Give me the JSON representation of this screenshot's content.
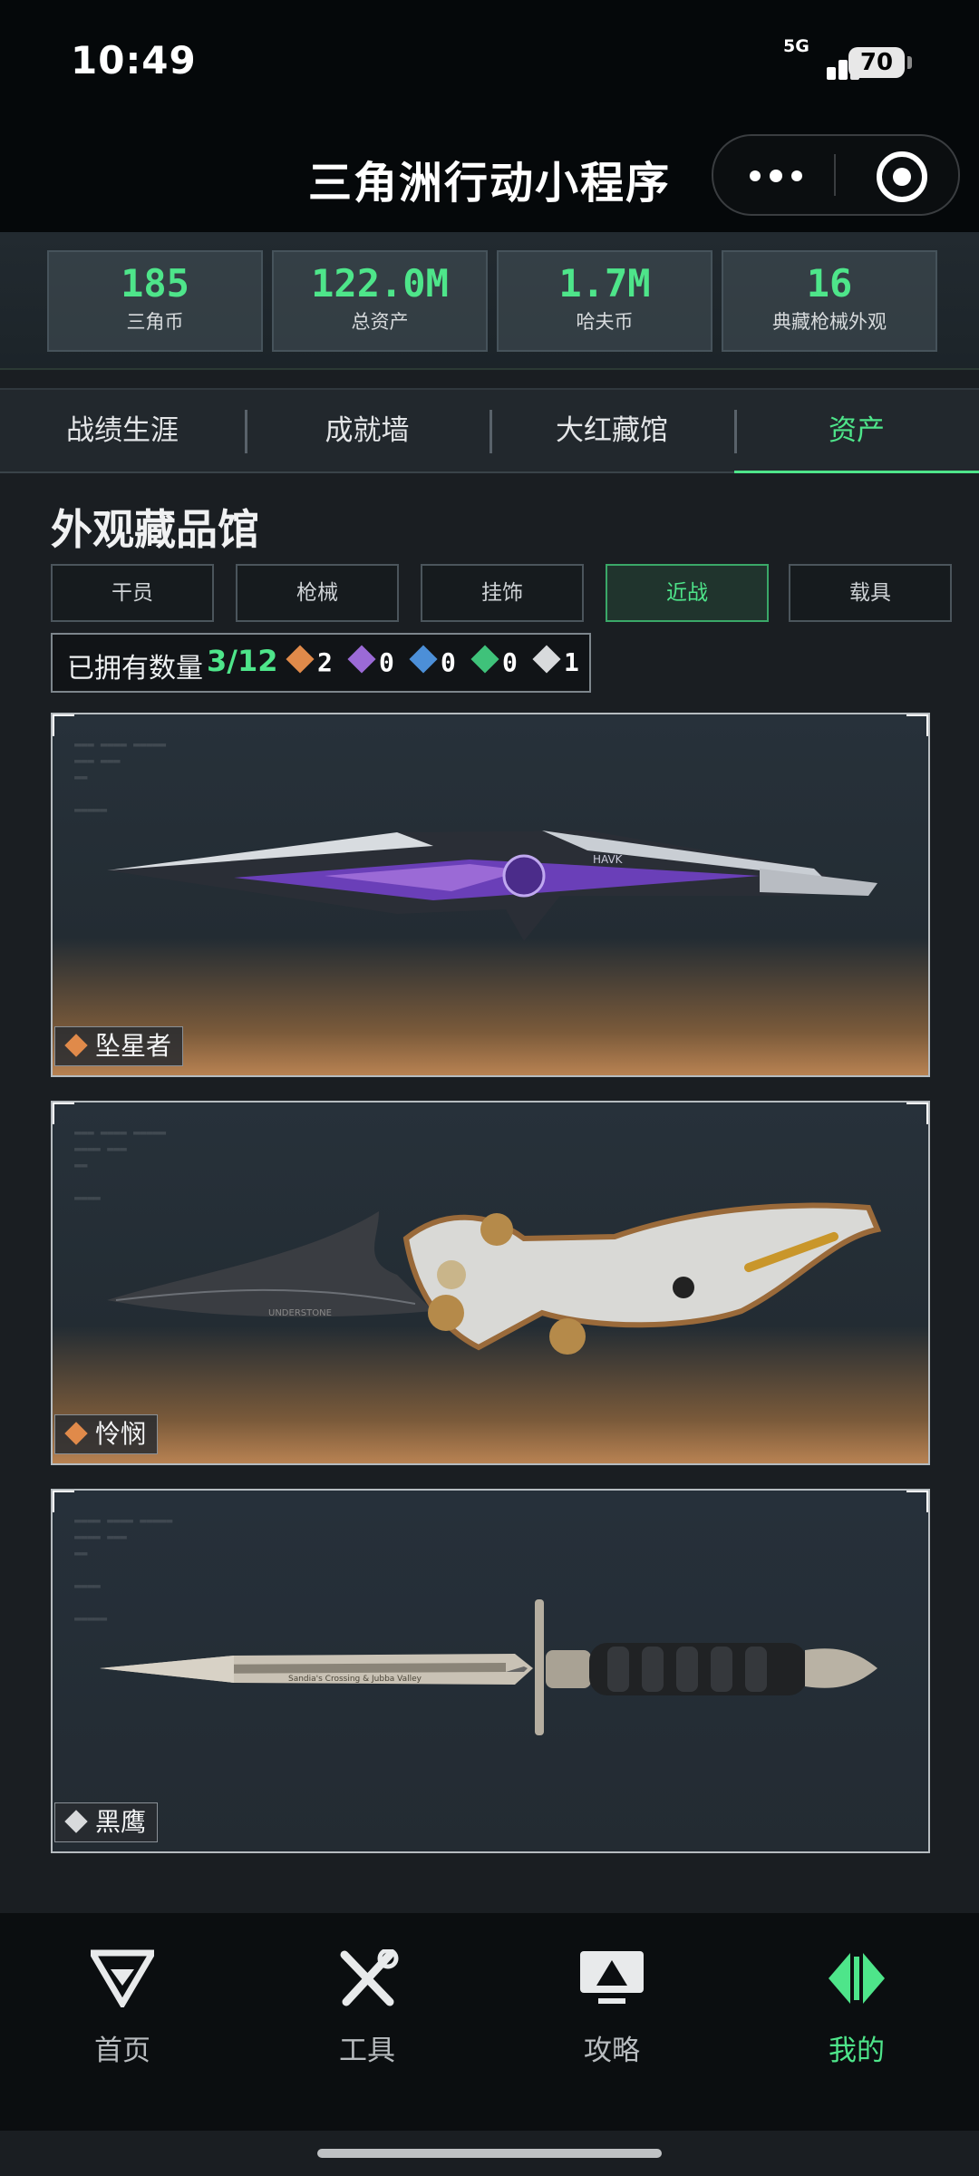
{
  "status_bar": {
    "time": "10:49",
    "network": "5G",
    "battery": "70"
  },
  "title_bar": {
    "title": "三角洲行动小程序"
  },
  "stats": [
    {
      "value": "185",
      "label": "三角币"
    },
    {
      "value": "122.0M",
      "label": "总资产"
    },
    {
      "value": "1.7M",
      "label": "哈夫币"
    },
    {
      "value": "16",
      "label": "典藏枪械外观"
    }
  ],
  "tabs": [
    {
      "label": "战绩生涯",
      "active": false
    },
    {
      "label": "成就墙",
      "active": false
    },
    {
      "label": "大红藏馆",
      "active": false
    },
    {
      "label": "资产",
      "active": true
    }
  ],
  "section": {
    "title": "外观藏品馆"
  },
  "categories": [
    {
      "label": "干员",
      "active": false
    },
    {
      "label": "枪械",
      "active": false
    },
    {
      "label": "挂饰",
      "active": false
    },
    {
      "label": "近战",
      "active": true
    },
    {
      "label": "载具",
      "active": false
    }
  ],
  "owned": {
    "label": "已拥有数量",
    "count": "3/12",
    "rarities": [
      {
        "icon": "orange-rarity-icon",
        "color": "#e08a4a",
        "count": "2"
      },
      {
        "icon": "purple-rarity-icon",
        "color": "#9b6ad6",
        "count": "0"
      },
      {
        "icon": "blue-rarity-icon",
        "color": "#4c8fd8",
        "count": "0"
      },
      {
        "icon": "green-rarity-icon",
        "color": "#3fc27a",
        "count": "0"
      },
      {
        "icon": "white-rarity-icon",
        "color": "#d8dadc",
        "count": "1"
      }
    ]
  },
  "items": [
    {
      "name": "坠星者",
      "rarity_color": "#e08a4a"
    },
    {
      "name": "怜悯",
      "rarity_color": "#e08a4a"
    },
    {
      "name": "黑鹰",
      "rarity_color": "#d8dadc"
    }
  ],
  "knife_prints": {
    "k1": "HAVK",
    "k2": "UNDERSTONE",
    "k3": "Sandia's Crossing & Jubba Valley"
  },
  "bottom_nav": [
    {
      "label": "首页",
      "icon": "home-logo-icon",
      "active": false
    },
    {
      "label": "工具",
      "icon": "tools-icon",
      "active": false
    },
    {
      "label": "攻略",
      "icon": "guide-icon",
      "active": false
    },
    {
      "label": "我的",
      "icon": "profile-icon",
      "active": true
    }
  ],
  "colors": {
    "accent": "#4ee58a",
    "background": "#1a1e22"
  }
}
